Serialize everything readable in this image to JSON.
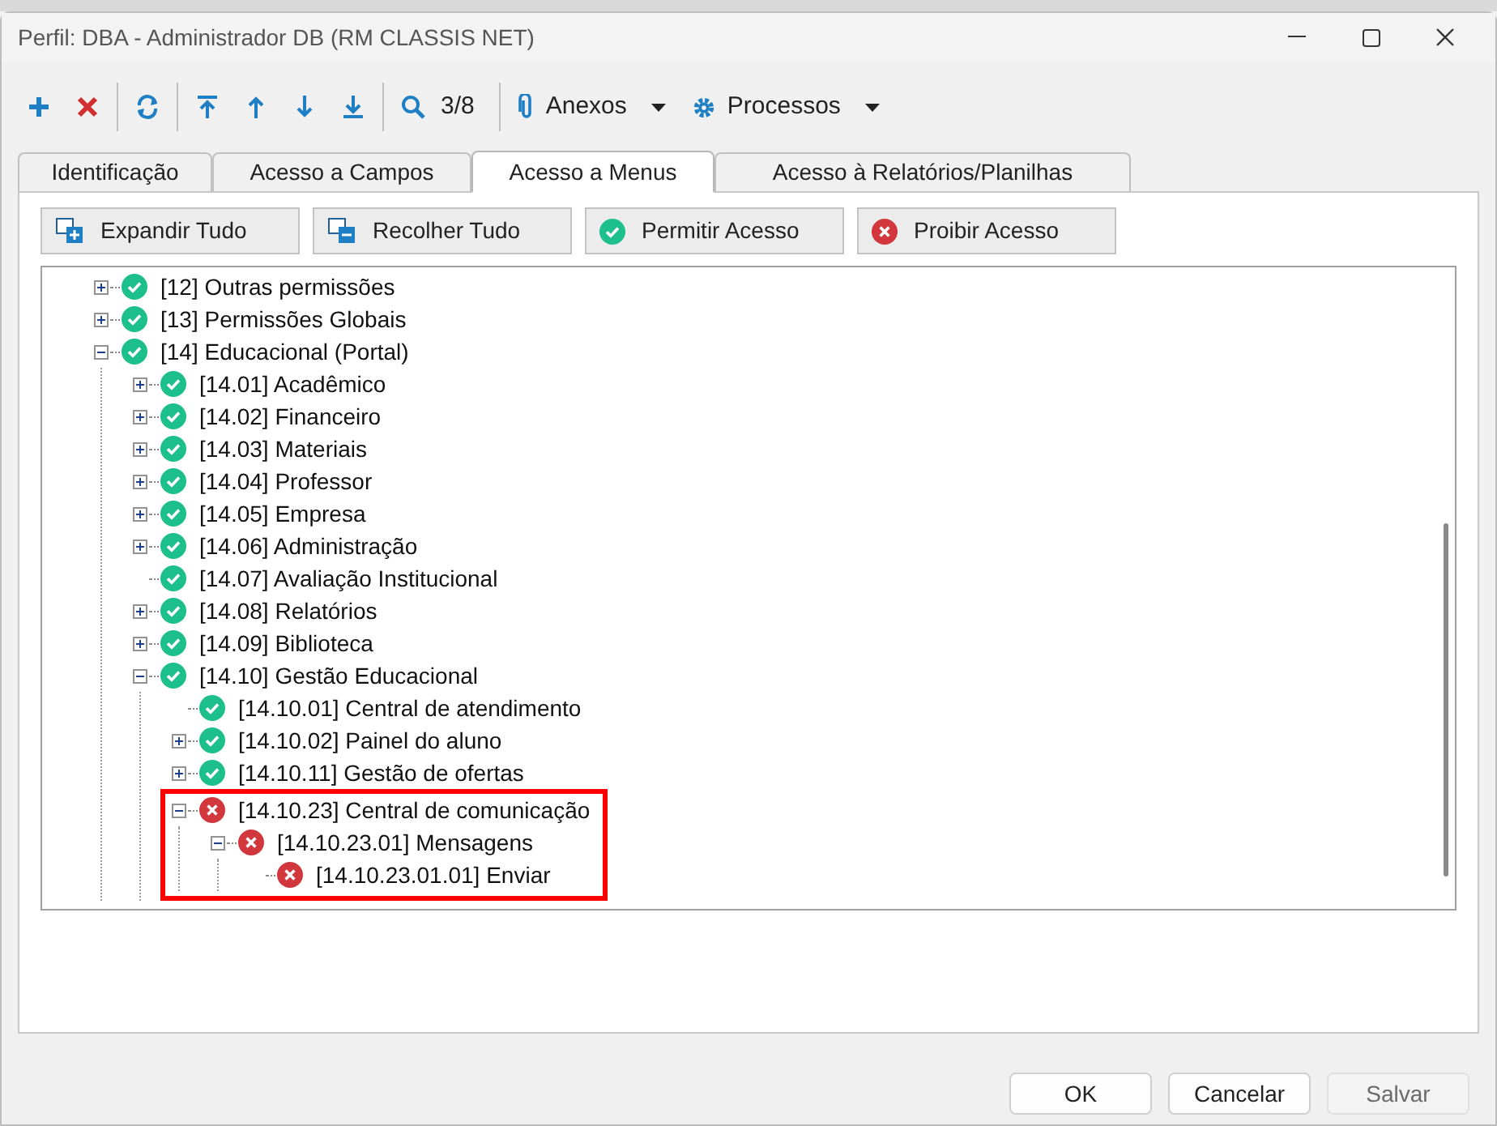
{
  "window": {
    "title": "Perfil: DBA - Administrador DB (RM CLASSIS NET)"
  },
  "toolbar": {
    "record_counter": "3/8",
    "menus": [
      {
        "label": "Anexos",
        "kind": "attach"
      },
      {
        "label": "Processos",
        "kind": "process"
      }
    ]
  },
  "tabs": [
    {
      "label": "Identificação",
      "selected": false
    },
    {
      "label": "Acesso a Campos",
      "selected": false
    },
    {
      "label": "Acesso a Menus",
      "selected": true
    },
    {
      "label": "Acesso à Relatórios/Planilhas",
      "selected": false
    }
  ],
  "actions": [
    {
      "label": "Expandir Tudo",
      "kind": "expand"
    },
    {
      "label": "Recolher Tudo",
      "kind": "collapse"
    },
    {
      "label": "Permitir Acesso",
      "kind": "allow"
    },
    {
      "label": "Proibir Acesso",
      "kind": "deny"
    }
  ],
  "tree": [
    {
      "label": "[12] Outras permissões",
      "allowed": true,
      "expanded": false
    },
    {
      "label": "[13] Permissões Globais",
      "allowed": true,
      "expanded": false
    },
    {
      "label": "[14] Educacional (Portal)",
      "allowed": true,
      "expanded": true,
      "children": [
        {
          "label": "[14.01] Acadêmico",
          "allowed": true,
          "expanded": false
        },
        {
          "label": "[14.02] Financeiro",
          "allowed": true,
          "expanded": false
        },
        {
          "label": "[14.03] Materiais",
          "allowed": true,
          "expanded": false
        },
        {
          "label": "[14.04] Professor",
          "allowed": true,
          "expanded": false
        },
        {
          "label": "[14.05] Empresa",
          "allowed": true,
          "expanded": false
        },
        {
          "label": "[14.06] Administração",
          "allowed": true,
          "expanded": false
        },
        {
          "label": "[14.07] Avaliação Institucional",
          "allowed": true
        },
        {
          "label": "[14.08] Relatórios",
          "allowed": true,
          "expanded": false
        },
        {
          "label": "[14.09] Biblioteca",
          "allowed": true,
          "expanded": false
        },
        {
          "label": "[14.10] Gestão Educacional",
          "allowed": true,
          "expanded": true,
          "children": [
            {
              "label": "[14.10.01] Central de atendimento",
              "allowed": true
            },
            {
              "label": "[14.10.02] Painel do aluno",
              "allowed": true,
              "expanded": false
            },
            {
              "label": "[14.10.11] Gestão de ofertas",
              "allowed": true,
              "expanded": false
            },
            {
              "label": "[14.10.23] Central de comunicação",
              "allowed": false,
              "expanded": true,
              "highlighted": true,
              "children": [
                {
                  "label": "[14.10.23.01] Mensagens",
                  "allowed": false,
                  "expanded": true,
                  "children": [
                    {
                      "label": "[14.10.23.01.01] Enviar",
                      "allowed": false
                    }
                  ]
                }
              ]
            }
          ]
        }
      ]
    }
  ],
  "footer_buttons": [
    {
      "label": "OK",
      "disabled": false
    },
    {
      "label": "Cancelar",
      "disabled": false
    },
    {
      "label": "Salvar",
      "disabled": true
    }
  ]
}
